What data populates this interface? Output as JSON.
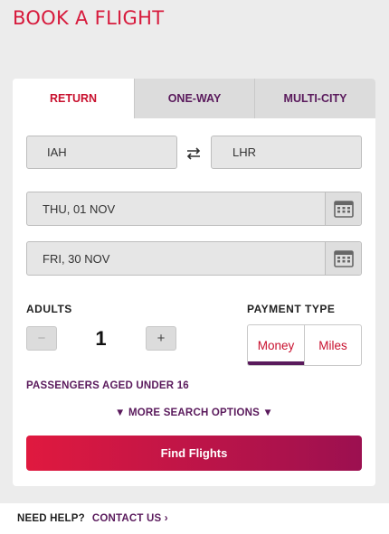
{
  "page_title": "BOOK A FLIGHT",
  "tabs": [
    {
      "label": "RETURN",
      "active": true
    },
    {
      "label": "ONE-WAY",
      "active": false
    },
    {
      "label": "MULTI-CITY",
      "active": false
    }
  ],
  "route": {
    "from": "IAH",
    "to": "LHR",
    "swap_icon": "swap-arrows-icon"
  },
  "dates": {
    "depart": "THU, 01 NOV",
    "return": "FRI, 30 NOV",
    "icon": "calendar-icon"
  },
  "passengers": {
    "label": "ADULTS",
    "count": "1",
    "minus": "−",
    "plus": "+"
  },
  "payment": {
    "label": "PAYMENT TYPE",
    "options": [
      "Money",
      "Miles"
    ],
    "selected": "Money"
  },
  "links": {
    "under16": "PASSENGERS AGED UNDER 16",
    "more_options": "▼ MORE SEARCH OPTIONS ▼"
  },
  "find_button": "Find Flights",
  "help": {
    "question": "NEED HELP?",
    "contact": "CONTACT US ›"
  },
  "colors": {
    "brand_red": "#c8102e",
    "purple": "#5a1a5c",
    "gradient_start": "#e0193f",
    "gradient_end": "#9c1050"
  }
}
